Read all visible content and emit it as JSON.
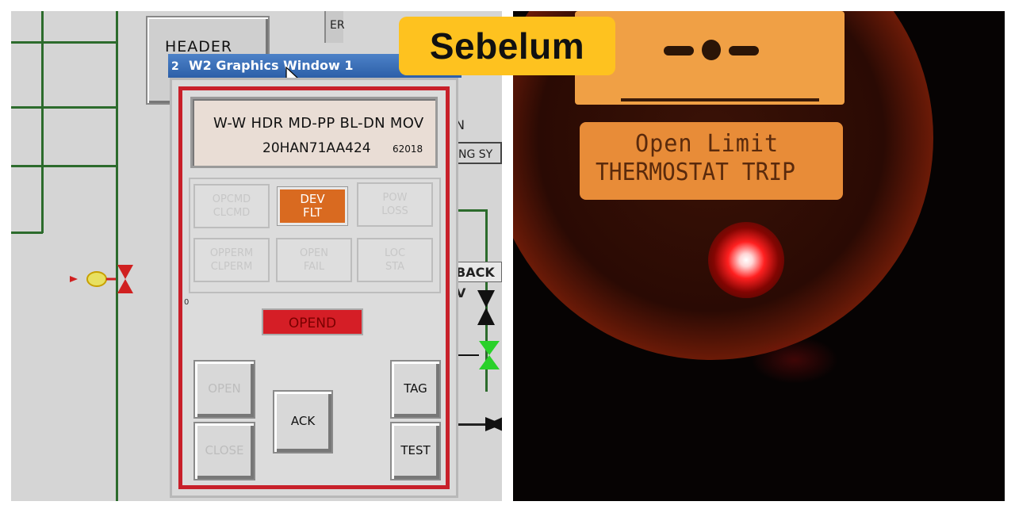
{
  "badge": {
    "label": "Sebelum"
  },
  "hmi": {
    "header_button": "HEADER",
    "strip_text": "ER",
    "side_labels": {
      "n": "N",
      "sy": "NG SY",
      "back": "BACK V"
    },
    "window": {
      "number": "2",
      "title": "W2 Graphics Window 1"
    },
    "tag": {
      "description": "W-W HDR MD-PP BL-DN MOV",
      "id": "20HAN71AA424",
      "code": "62018"
    },
    "status_cells": [
      {
        "line1": "OPCMD",
        "line2": "CLCMD",
        "active": false
      },
      {
        "line1": "DEV",
        "line2": "FLT",
        "active": true
      },
      {
        "line1": "POW",
        "line2": "LOSS",
        "active": false
      },
      {
        "line1": "OPPERM",
        "line2": "CLPERM",
        "active": false
      },
      {
        "line1": "OPEN",
        "line2": "FAIL",
        "active": false
      },
      {
        "line1": "LOC",
        "line2": "STA",
        "active": false
      }
    ],
    "status_value": "OPEND",
    "zero_mark": "0",
    "buttons": {
      "open": "OPEN",
      "close": "CLOSE",
      "ack": "ACK",
      "tag": "TAG",
      "test": "TEST"
    },
    "colors": {
      "active_cell": "#d96a20",
      "alarm_red": "#d51e26",
      "frame_red": "#c8202a"
    }
  },
  "device_display": {
    "line1": "Open Limit",
    "line2": "THERMOSTAT TRIP",
    "led_color": "#ff2020"
  }
}
